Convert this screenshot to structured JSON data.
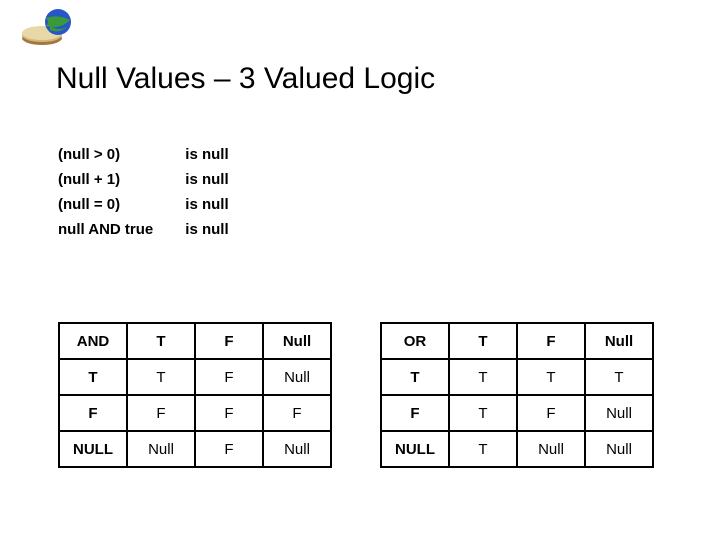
{
  "title": "Null Values – 3 Valued Logic",
  "expressions": [
    {
      "lhs": "(null > 0)",
      "rhs": "is null"
    },
    {
      "lhs": "(null + 1)",
      "rhs": "is null"
    },
    {
      "lhs": "(null = 0)",
      "rhs": "is null"
    },
    {
      "lhs": "null AND true",
      "rhs": "is null"
    }
  ],
  "and_table": {
    "op": "AND",
    "cols": [
      "T",
      "F",
      "Null"
    ],
    "rows": [
      {
        "label": "T",
        "cells": [
          "T",
          "F",
          "Null"
        ]
      },
      {
        "label": "F",
        "cells": [
          "F",
          "F",
          "F"
        ]
      },
      {
        "label": "NULL",
        "cells": [
          "Null",
          "F",
          "Null"
        ]
      }
    ]
  },
  "or_table": {
    "op": "OR",
    "cols": [
      "T",
      "F",
      "Null"
    ],
    "rows": [
      {
        "label": "T",
        "cells": [
          "T",
          "T",
          "T"
        ]
      },
      {
        "label": "F",
        "cells": [
          "T",
          "F",
          "Null"
        ]
      },
      {
        "label": "NULL",
        "cells": [
          "T",
          "Null",
          "Null"
        ]
      }
    ]
  }
}
